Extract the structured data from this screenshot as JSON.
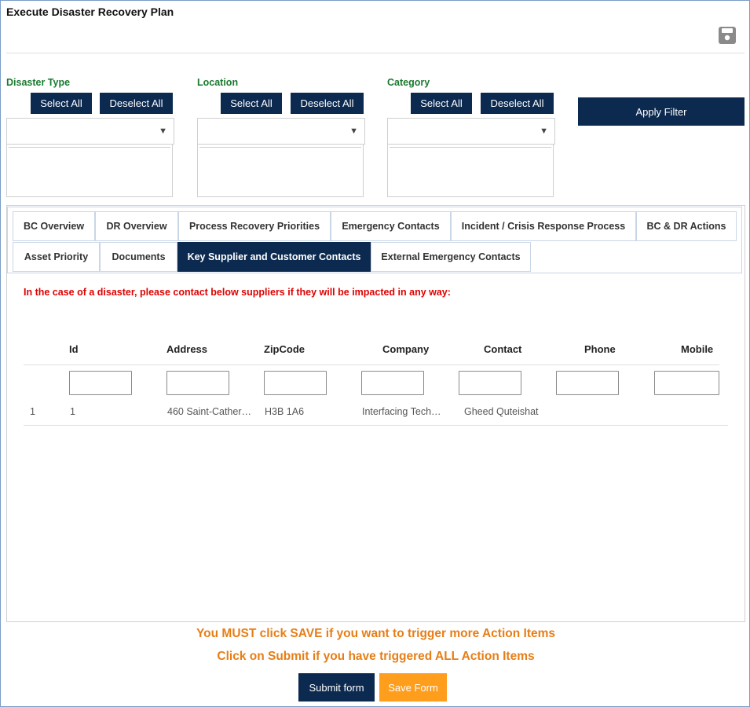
{
  "page": {
    "title": "Execute Disaster Recovery Plan"
  },
  "filters": {
    "select_all_label": "Select All",
    "deselect_all_label": "Deselect All",
    "apply_label": "Apply Filter",
    "disaster_type": {
      "label": "Disaster Type",
      "value": ""
    },
    "location": {
      "label": "Location",
      "value": ""
    },
    "category": {
      "label": "Category",
      "value": ""
    }
  },
  "tabs": {
    "row1": [
      "BC Overview",
      "DR Overview",
      "Process Recovery Priorities",
      "Emergency Contacts",
      "Incident / Crisis Response Process",
      "BC & DR Actions"
    ],
    "row2": [
      "Asset Priority",
      "Documents",
      "Key Supplier and Customer Contacts",
      "External Emergency Contacts"
    ],
    "active": "Key Supplier and Customer Contacts"
  },
  "notice": "In the case of a disaster, please contact below suppliers if they will be impacted in any way:",
  "table": {
    "columns": [
      "Id",
      "Address",
      "ZipCode",
      "Company",
      "Contact",
      "Phone",
      "Mobile"
    ],
    "rows": [
      {
        "index": "1",
        "id": "1",
        "address": "460 Saint-Cather…",
        "zipcode": "H3B 1A6",
        "company": "Interfacing Tech…",
        "contact": "Gheed Quteishat",
        "phone": "",
        "mobile": ""
      }
    ]
  },
  "messages": {
    "save_notice": "You MUST click SAVE if you want to trigger more Action Items",
    "submit_notice": "Click on Submit if you have triggered ALL Action Items"
  },
  "actions": {
    "submit_label": "Submit form",
    "save_label": "Save Form"
  },
  "colors": {
    "navy": "#0c2a4f",
    "green_label": "#1a7a30",
    "notice_red": "#e00000",
    "orange": "#e67e17",
    "save_button": "#ff9d1c"
  },
  "icons": {
    "save": "floppy-disk-icon",
    "dropdown": "triangle-down-icon"
  }
}
